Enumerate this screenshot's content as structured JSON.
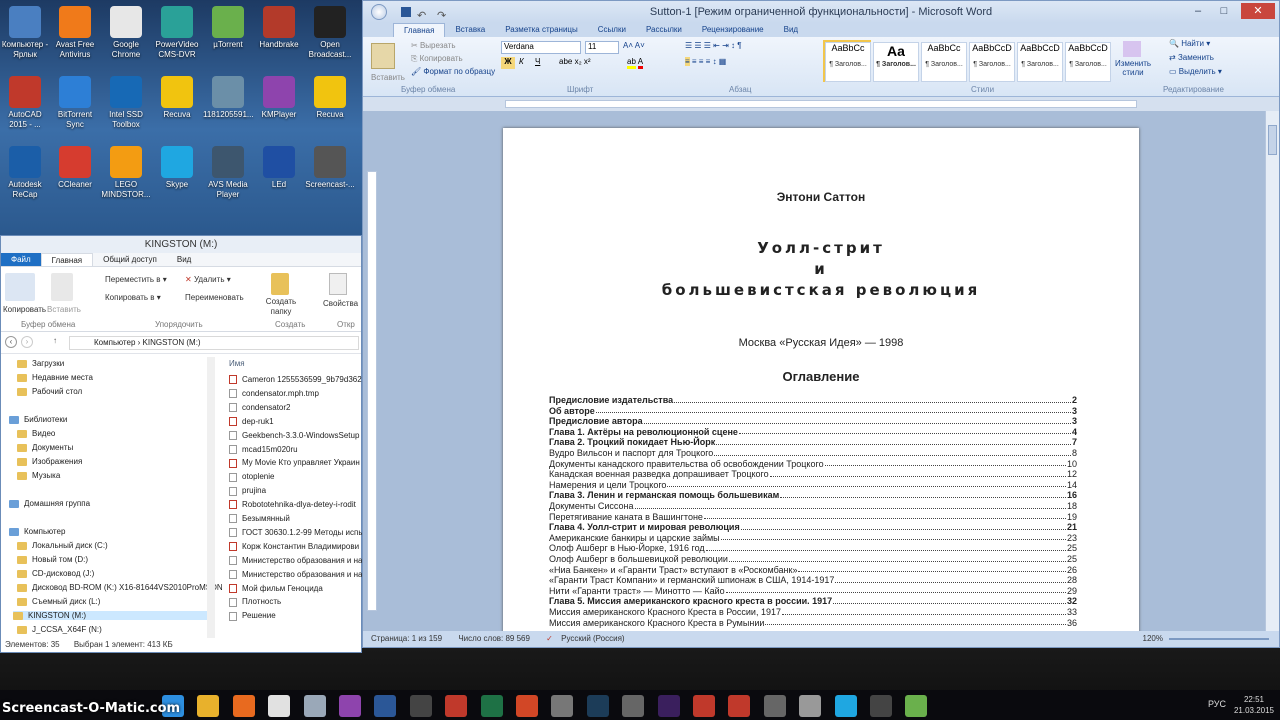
{
  "desktop": {
    "icons": [
      {
        "label": "Компьютер - Ярлык",
        "color": "#4a7fc1"
      },
      {
        "label": "Avast Free Antivirus",
        "color": "#f07a1a"
      },
      {
        "label": "Google Chrome",
        "color": "#e7e7e7"
      },
      {
        "label": "PowerVideo CMS-DVR",
        "color": "#2aa198"
      },
      {
        "label": "µTorrent",
        "color": "#6ab04c"
      },
      {
        "label": "Handbrake",
        "color": "#b33a2a"
      },
      {
        "label": "Open Broadcast...",
        "color": "#222222"
      },
      {
        "label": "AutoCAD 2015 - ...",
        "color": "#c0392b"
      },
      {
        "label": "BitTorrent Sync",
        "color": "#2d7fd6"
      },
      {
        "label": "Intel SSD Toolbox",
        "color": "#1769b5"
      },
      {
        "label": "Recuva",
        "color": "#f1c40f"
      },
      {
        "label": "1181205591...",
        "color": "#6b8fa8"
      },
      {
        "label": "KMPlayer",
        "color": "#8e44ad"
      },
      {
        "label": "Recuva",
        "color": "#f1c40f"
      },
      {
        "label": "Autodesk ReCap",
        "color": "#1b5ea8"
      },
      {
        "label": "CCleaner",
        "color": "#d63c2f"
      },
      {
        "label": "LEGO MINDSTOR...",
        "color": "#f39c12"
      },
      {
        "label": "Skype",
        "color": "#1fa7e1"
      },
      {
        "label": "AVS Media Player",
        "color": "#3d566e"
      },
      {
        "label": "LEd",
        "color": "#1f4fa3"
      },
      {
        "label": "Screencast-...",
        "color": "#555555"
      }
    ]
  },
  "explorer": {
    "title": "KINGSTON (M:)",
    "tabs": [
      "Файл",
      "Главная",
      "Общий доступ",
      "Вид"
    ],
    "ribbon": {
      "copy": "Копировать",
      "paste": "Вставить",
      "move_to": "Переместить в",
      "delete": "Удалить",
      "copy_to": "Копировать в",
      "rename": "Переименовать",
      "new_folder": "Создать папку",
      "properties": "Свойства",
      "groups": [
        "Буфер обмена",
        "Упорядочить",
        "Создать",
        "Откр"
      ]
    },
    "address": {
      "parts": [
        "Компьютер",
        "KINGSTON (M:)"
      ]
    },
    "nav": [
      {
        "label": "Загрузки",
        "indent": 1
      },
      {
        "label": "Недавние места",
        "indent": 1
      },
      {
        "label": "Рабочий стол",
        "indent": 1
      },
      {
        "label": "Библиотеки",
        "indent": 0
      },
      {
        "label": "Видео",
        "indent": 1
      },
      {
        "label": "Документы",
        "indent": 1
      },
      {
        "label": "Изображения",
        "indent": 1
      },
      {
        "label": "Музыка",
        "indent": 1
      },
      {
        "label": "Домашняя группа",
        "indent": 0
      },
      {
        "label": "Компьютер",
        "indent": 0
      },
      {
        "label": "Локальный диск (C:)",
        "indent": 1
      },
      {
        "label": "Новый том (D:)",
        "indent": 1
      },
      {
        "label": "CD-дисковод (J:)",
        "indent": 1
      },
      {
        "label": "Дисковод BD-ROM (K:) X16-81644VS2010ProMSDN",
        "indent": 1
      },
      {
        "label": "Съемный диск (L:)",
        "indent": 1
      },
      {
        "label": "KINGSTON (M:)",
        "indent": 1
      },
      {
        "label": "J_CCSA_X64F (N:)",
        "indent": 1
      }
    ],
    "column_name": "Имя",
    "files": [
      "Cameron 1255536599_9b79d362",
      "condensator.mph.tmp",
      "condensator2",
      "dep-ruk1",
      "Geekbench-3.3.0-WindowsSetup",
      "mcad15m020ru",
      "My Movie Кто управляет Украин",
      "otoplenie",
      "prujina",
      "Robototehnika-dlya-detey-i-rodit",
      "Безымянный",
      "ГОСТ 30630.1.2-99 Методы испы",
      "Корж Константин Владимирови",
      "Министерство образования и на",
      "Министерство образования и на",
      "Мой фильм Геноцида",
      "Плотность",
      "Решение"
    ],
    "status": [
      "Элементов: 35",
      "Выбран 1 элемент: 413 КБ"
    ]
  },
  "word": {
    "title": "Sutton-1 [Режим ограниченной функциональности] - Microsoft Word",
    "tabs": [
      "Главная",
      "Вставка",
      "Разметка страницы",
      "Ссылки",
      "Рассылки",
      "Рецензирование",
      "Вид"
    ],
    "ribbon": {
      "paste": "Вставить",
      "cut": "Вырезать",
      "copy": "Копировать",
      "format_painter": "Формат по образцу",
      "font": "Verdana",
      "size": "11",
      "groups": [
        "Буфер обмена",
        "Шрифт",
        "Абзац",
        "Стили",
        "Редактирование"
      ],
      "styles": [
        {
          "sample": "AaBbCc",
          "name": "¶ Заголов..."
        },
        {
          "sample": "Aa",
          "name": "¶ Заголов..."
        },
        {
          "sample": "AaBbCc",
          "name": "¶ Заголов..."
        },
        {
          "sample": "AaBbCcD",
          "name": "¶ Заголов..."
        },
        {
          "sample": "AaBbCcD",
          "name": "¶ Заголов..."
        },
        {
          "sample": "AaBbCcD",
          "name": "¶ Заголов..."
        }
      ],
      "change_styles": "Изменить стили",
      "find": "Найти",
      "replace": "Заменить",
      "select": "Выделить"
    },
    "document": {
      "author": "Энтони Саттон",
      "title_lines": [
        "Уолл-стрит",
        "и",
        "большевистская революция"
      ],
      "publisher": "Москва «Русская Идея» — 1998",
      "toc_heading": "Оглавление",
      "toc": [
        {
          "t": "Предисловие издательства",
          "p": "2",
          "b": true
        },
        {
          "t": "Об авторе",
          "p": "3",
          "b": true
        },
        {
          "t": "Предисловие автора",
          "p": "3",
          "b": true
        },
        {
          "t": "Глава 1. Актёры на революционной сцене",
          "p": "4",
          "b": true
        },
        {
          "t": "Глава 2. Троцкий покидает Нью-Йорк",
          "p": "7",
          "b": true
        },
        {
          "t": "Вудро Вильсон и паспорт для Троцкого",
          "p": "8",
          "b": false
        },
        {
          "t": "Документы канадского правительства  об освобождении Троцкого",
          "p": "10",
          "b": false
        },
        {
          "t": "Канадская военная разведка  допрашивает Троцкого",
          "p": "12",
          "b": false
        },
        {
          "t": "Намерения и цели Троцкого",
          "p": "14",
          "b": false
        },
        {
          "t": "Глава 3. Ленин и германская помощь большевикам",
          "p": "16",
          "b": true
        },
        {
          "t": "Документы Сиссона",
          "p": "18",
          "b": false
        },
        {
          "t": "Перетягивание каната в Вашингтоне",
          "p": "19",
          "b": false
        },
        {
          "t": "Глава 4. Уолл-стрит и мировая революция",
          "p": "21",
          "b": true
        },
        {
          "t": "Американские банкиры и царские займы",
          "p": "23",
          "b": false
        },
        {
          "t": "Олоф Ашберг в Нью-Йорке, 1916 год",
          "p": "25",
          "b": false
        },
        {
          "t": "Олоф Ашберг в  большевицкой революции",
          "p": "25",
          "b": false
        },
        {
          "t": "«Ниа Банкен» и «Гаранти Траст»  вступают в «Роскомбанк»",
          "p": "26",
          "b": false
        },
        {
          "t": "«Гаранти Траст Компани» и германский шпионаж в США, 1914-1917",
          "p": "28",
          "b": false
        },
        {
          "t": "Нити «Гаранти траст» —  Минотто — Кайо",
          "p": "29",
          "b": false
        },
        {
          "t": "Глава 5. Миссия американского красного креста в россии. 1917",
          "p": "32",
          "b": true
        },
        {
          "t": "Миссия американского  Красного Креста в России, 1917",
          "p": "33",
          "b": false
        },
        {
          "t": "Миссия американского  Красного Креста в Румынии",
          "p": "36",
          "b": false
        }
      ]
    },
    "status": {
      "page": "Страница: 1 из 159",
      "words": "Число слов: 89 569",
      "lang": "Русский (Россия)",
      "zoom": "120%"
    }
  },
  "taskbar": {
    "brand": "Screencast-O-Matic.com",
    "lang": "РУС",
    "time": "22:51",
    "date": "21.03.2015",
    "apps": [
      {
        "name": "ie-icon",
        "color": "#2d8fe0"
      },
      {
        "name": "chrome-icon",
        "color": "#e8b12c"
      },
      {
        "name": "firefox-icon",
        "color": "#e86a1f"
      },
      {
        "name": "yandex-icon",
        "color": "#e1e1e1"
      },
      {
        "name": "file-icon",
        "color": "#9aa8b8"
      },
      {
        "name": "kmplayer-icon",
        "color": "#8e44ad"
      },
      {
        "name": "word-icon",
        "color": "#2b5797"
      },
      {
        "name": "sony-icon",
        "color": "#444444"
      },
      {
        "name": "filezilla-icon",
        "color": "#c0392b"
      },
      {
        "name": "excel-icon",
        "color": "#1e7145"
      },
      {
        "name": "powerpoint-icon",
        "color": "#d24726"
      },
      {
        "name": "tool-icon",
        "color": "#777777"
      },
      {
        "name": "photoshop-icon",
        "color": "#1c3c58"
      },
      {
        "name": "app-icon",
        "color": "#666666"
      },
      {
        "name": "aftereffects-icon",
        "color": "#3a1f5d"
      },
      {
        "name": "autocad-icon",
        "color": "#c0392b"
      },
      {
        "name": "acrobat-icon",
        "color": "#c0392b"
      },
      {
        "name": "app2-icon",
        "color": "#666666"
      },
      {
        "name": "mail-icon",
        "color": "#999999"
      },
      {
        "name": "skype-icon",
        "color": "#1fa7e1"
      },
      {
        "name": "app3-icon",
        "color": "#444444"
      },
      {
        "name": "utorrent-icon",
        "color": "#6ab04c"
      }
    ]
  }
}
